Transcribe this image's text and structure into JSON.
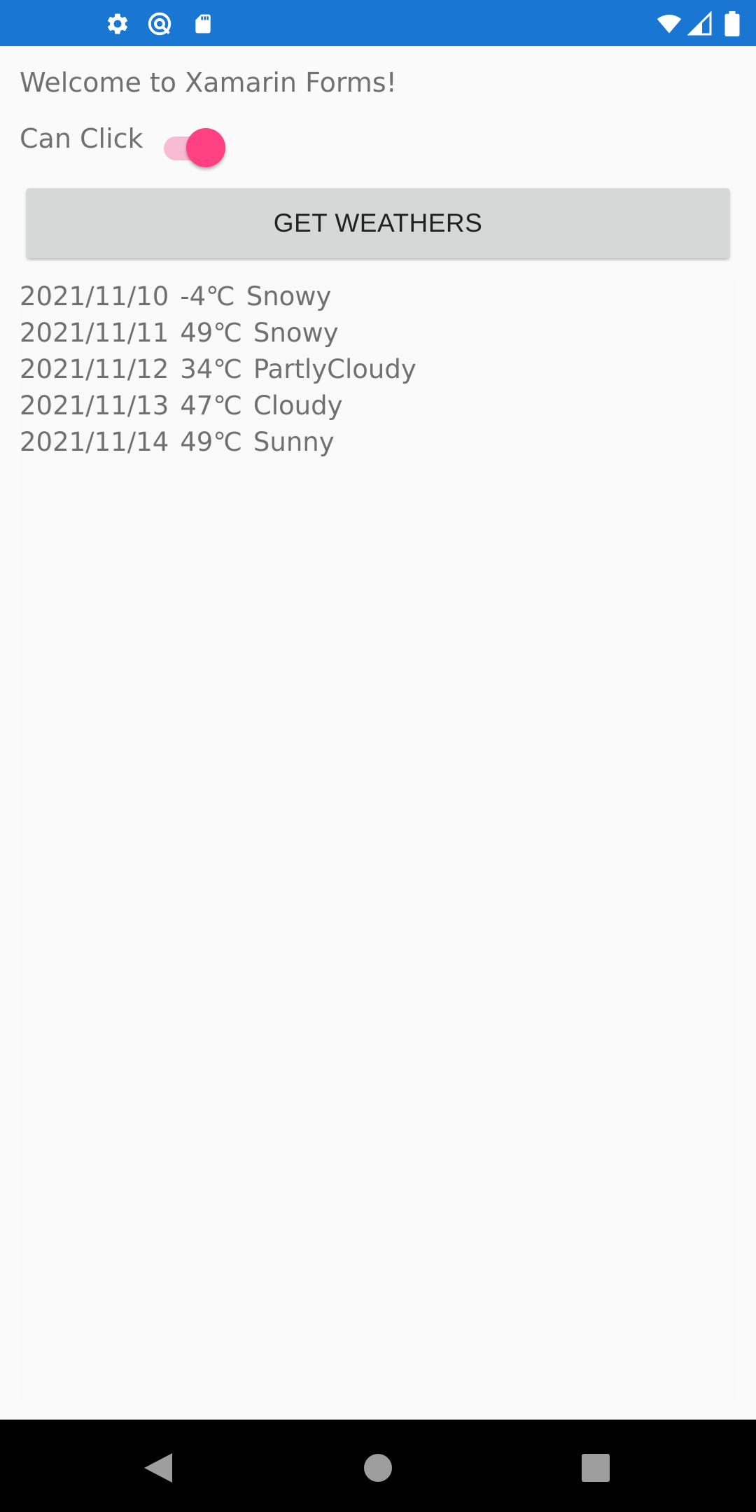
{
  "status_bar": {
    "background": "#1976d2",
    "left_icons": [
      "gear-icon",
      "at-sign-icon",
      "sd-card-icon"
    ],
    "right_icons": [
      "wifi-icon",
      "signal-icon",
      "battery-icon"
    ]
  },
  "page": {
    "welcome_text": "Welcome to Xamarin Forms!",
    "can_click_label": "Can Click",
    "can_click_on": true,
    "switch_color": "#ff4081",
    "get_button_label": "GET WEATHERS"
  },
  "weather_list": [
    {
      "date": "2021/11/10",
      "temp": "-4℃",
      "condition": "Snowy"
    },
    {
      "date": "2021/11/11",
      "temp": "49℃",
      "condition": "Snowy"
    },
    {
      "date": "2021/11/12",
      "temp": "34℃",
      "condition": "PartlyCloudy"
    },
    {
      "date": "2021/11/13",
      "temp": "47℃",
      "condition": "Cloudy"
    },
    {
      "date": "2021/11/14",
      "temp": "49℃",
      "condition": "Sunny"
    }
  ],
  "nav_bar": {
    "buttons": [
      "back-icon",
      "home-icon",
      "recents-icon"
    ]
  }
}
